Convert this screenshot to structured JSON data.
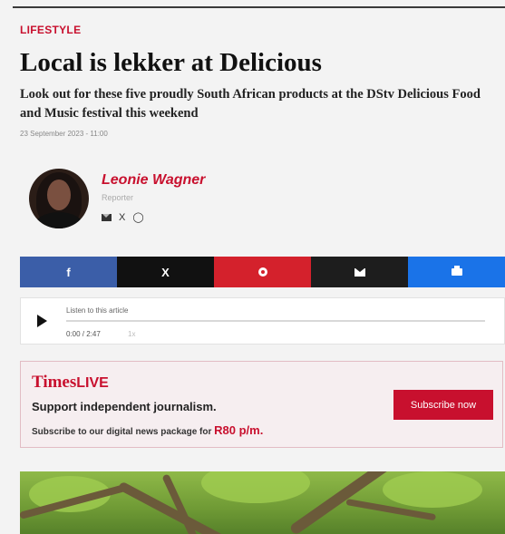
{
  "article": {
    "category": "LIFESTYLE",
    "headline": "Local is lekker at Delicious",
    "standfirst": "Look out for these five proudly South African products at the DStv Delicious Food and Music festival this weekend",
    "date": "23 September 2023 - 11:00"
  },
  "author": {
    "name": "Leonie Wagner",
    "role": "Reporter",
    "social_icons": [
      "email-icon",
      "x-icon",
      "instagram-icon"
    ]
  },
  "share_bar": {
    "buttons": [
      {
        "icon": "facebook-icon",
        "glyph": "f",
        "color": "#3b5ea8"
      },
      {
        "icon": "x-icon",
        "glyph": "X",
        "color": "#111111"
      },
      {
        "icon": "pinterest-icon",
        "color": "#d4212c"
      },
      {
        "icon": "email-icon",
        "color": "#1d1d1d"
      },
      {
        "icon": "print-icon",
        "color": "#1a73e8"
      }
    ]
  },
  "audio_player": {
    "label": "Listen to this article",
    "time": "0:00 / 2:47",
    "speed": "1x",
    "progress": 0
  },
  "promo": {
    "logo_main": "Times",
    "logo_live": "LIVE",
    "headline": "Support independent journalism.",
    "subline": "Subscribe to our digital news package for",
    "price": "R80 p/m.",
    "button": "Subscribe now",
    "accent": "#c8102e"
  },
  "x_glyph": "X"
}
